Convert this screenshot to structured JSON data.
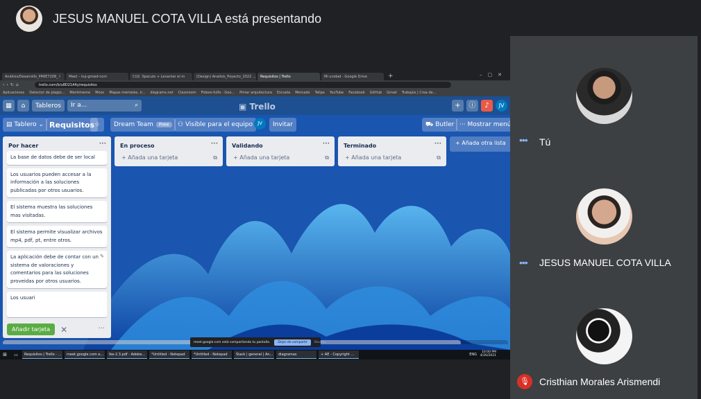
{
  "meet": {
    "presenting_label": "JESUS MANUEL COTA VILLA está presentando"
  },
  "browser": {
    "tabs": [
      {
        "label": "Análisis/Desarrollo_PR6E7208_ I"
      },
      {
        "label": "Meet – kuj-gmwd-ncm"
      },
      {
        "label": "CU2. Speculo + Levantar el m"
      },
      {
        "label": "(Design) Analisis_Poyecto_2022 ..."
      },
      {
        "label": "Requisitos | Trello"
      },
      {
        "label": "Mi unidad - Google Drive"
      }
    ],
    "url": "trello.com/b/u8D21A4y/requisitos",
    "bookmarks": [
      "Aplicaciones",
      "Detector de plagio...",
      "Mentimeme",
      "Mooc",
      "Mapas mentales, ir...",
      "diagrams.net",
      "Classroom",
      "Fideos-fulfo - Goo...",
      "Pintar arquitectura",
      "Escuela",
      "Mercado",
      "Telipe",
      "YouTube",
      "Facebook",
      "GitHub",
      "Gmail",
      "Trabajos | Crea de..."
    ]
  },
  "trello": {
    "tableros": "Tableros",
    "search_placeholder": "Ir a...",
    "logo": "Trello",
    "avatar_initials": "JV",
    "board_menu": "Tablero",
    "board_name": "Requisitos",
    "team": "Dream Team",
    "team_hint": "Free",
    "visibility": "Visible para el equipo",
    "invite": "Invitar",
    "butler": "Butler",
    "show_menu": "Mostrar menú",
    "add_list": "Añada otra lista",
    "lists": [
      {
        "title": "Por hacer",
        "cards": [
          "La base de datos debe de ser local",
          "Los usuarios pueden accesar a la información a las soluciones publicadas por otros usuarios.",
          "El sistema muestra las soluciones mas visitadas.",
          "El sistema permite visualizar archivos mp4, pdf, pt, entre otros.",
          "La aplicación debe de contar con un sistema de valoraciones y comentarios para las soluciones proveidas por otros usuarios."
        ],
        "editing_text": "Los usuari",
        "add_card_button": "Añadir tarjeta"
      },
      {
        "title": "En proceso",
        "add_card": "Añada una tarjeta"
      },
      {
        "title": "Validando",
        "add_card": "Añada una tarjeta"
      },
      {
        "title": "Terminado",
        "add_card": "Añada una tarjeta"
      }
    ]
  },
  "share_notice": {
    "text": "meet.google.com está compartiendo tu pantalla.",
    "stop": "Dejar de compartir",
    "hide": "Ocultar"
  },
  "taskbar": {
    "apps": [
      "Requisitos | Trello - ...",
      "meet.google.com e...",
      "lke-2.3.pdf - Adobe...",
      "*Untitled - Notepad",
      "*Untitled - Notepad",
      "Slack | general | An...",
      "diagramas",
      "+ AE - Copyright ..."
    ],
    "time": "10:00 PM",
    "date": "4/26/2021",
    "lang": "ENG"
  },
  "participants": [
    {
      "name": "Tú",
      "status": "talking"
    },
    {
      "name": "JESUS MANUEL COTA VILLA",
      "status": "talking"
    },
    {
      "name": "Cristhian Morales Arismendi",
      "status": "muted"
    }
  ]
}
